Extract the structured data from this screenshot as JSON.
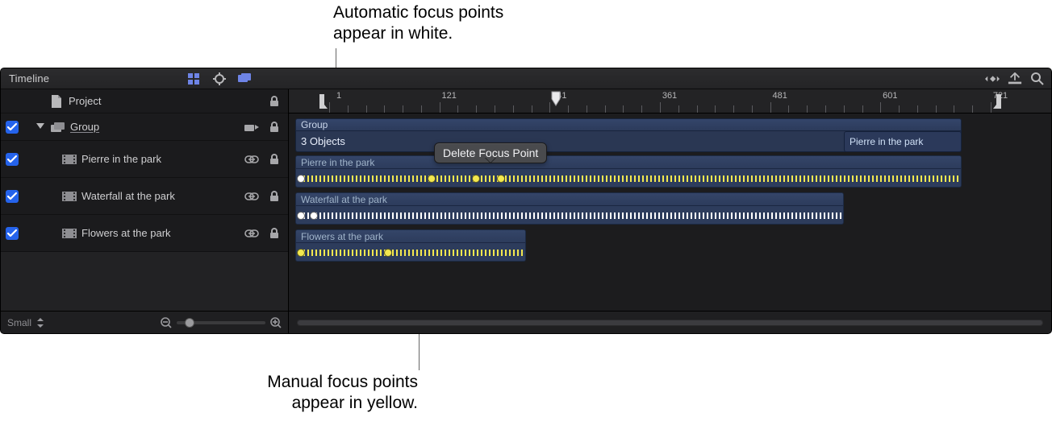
{
  "callouts": {
    "top_text": "Automatic focus points\nappear in white.",
    "bottom_text": "Manual focus points\nappear in yellow."
  },
  "header": {
    "title": "Timeline"
  },
  "sidebar": {
    "rows": [
      {
        "label": "Project"
      },
      {
        "label": "Group"
      },
      {
        "label": "Pierre in the park"
      },
      {
        "label": "Waterfall at the park"
      },
      {
        "label": "Flowers at the park"
      }
    ],
    "footer": {
      "size_label": "Small"
    }
  },
  "ruler": {
    "ticks": [
      1,
      121,
      241,
      361,
      481,
      601,
      721
    ],
    "playhead": 241
  },
  "timeline": {
    "group_label": "Group",
    "group_sub": "3 Objects",
    "group_inset": "Pierre in the park",
    "clips": [
      {
        "label": "Pierre in the park"
      },
      {
        "label": "Waterfall at the park"
      },
      {
        "label": "Flowers at the park"
      }
    ],
    "popup": "Delete Focus Point"
  }
}
